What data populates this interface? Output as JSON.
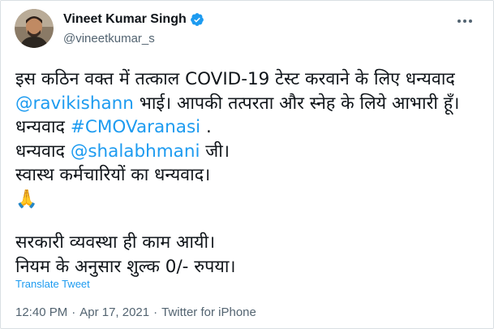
{
  "author": {
    "name": "Vineet Kumar Singh",
    "handle": "@vineetkumar_s",
    "verified": true
  },
  "tweet": {
    "line1": "इस कठिन वक्त में तत्काल COVID-19 टेस्ट करवाने के लिए धन्यवाद",
    "line2_mention": "@ravikishann",
    "line2_rest": " भाई। आपकी तत्परता और स्नेह के लिये आभारी हूँ।",
    "line3_prefix": "धन्यवाद ",
    "line3_hashtag": "#CMOVaranasi",
    "line3_suffix": " .",
    "line4_prefix": "धन्यवाद ",
    "line4_mention": "@shalabhmani",
    "line4_suffix": " जी।",
    "line5": "स्वास्थ कर्मचारियों का धन्यवाद।",
    "emoji": "🙏",
    "line7": "सरकारी व्यवस्था ही काम आयी।",
    "line8": "नियम के अनुसार शुल्क 0/- रुपया।"
  },
  "translate_label": "Translate Tweet",
  "meta": {
    "time": "12:40 PM",
    "date": "Apr 17, 2021",
    "source": "Twitter for iPhone"
  },
  "icons": {
    "avatar": "profile-photo",
    "verified": "verified-badge-icon",
    "more": "more-options-icon"
  },
  "colors": {
    "link": "#1d9bf0",
    "secondary_text": "#536471"
  }
}
